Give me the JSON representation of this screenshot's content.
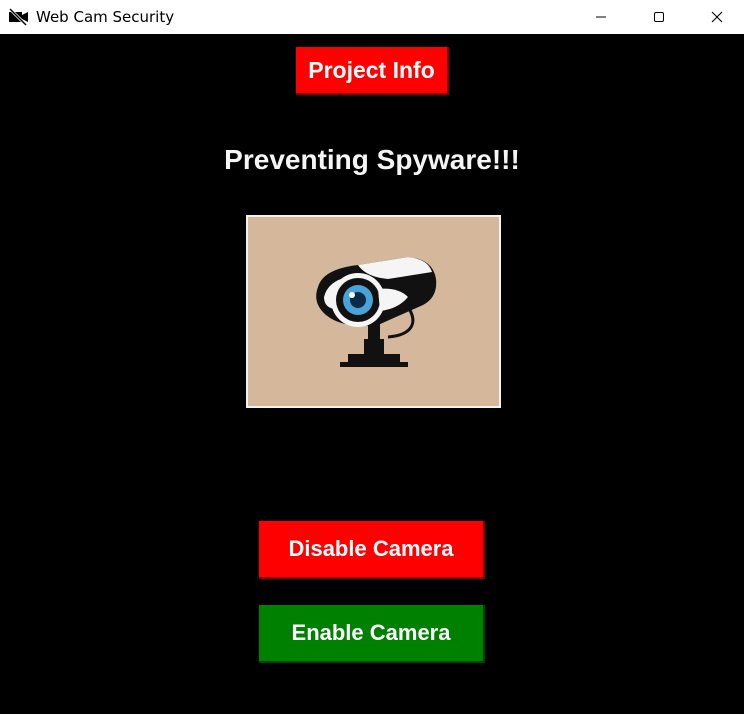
{
  "window": {
    "title": "Web Cam Security",
    "icon": "camera-off-icon",
    "controls": [
      "minimize-icon",
      "maximize-icon",
      "close-icon"
    ]
  },
  "main": {
    "project_info_label": "Project Info",
    "heading": "Preventing Spyware!!!",
    "image_icon": "security-camera-icon",
    "disable_label": "Disable Camera",
    "enable_label": "Enable Camera"
  },
  "colors": {
    "background": "#000000",
    "disable_button": "#ff0000",
    "enable_button": "#008000",
    "project_button": "#ff0000",
    "image_background": "#d5b89b"
  }
}
